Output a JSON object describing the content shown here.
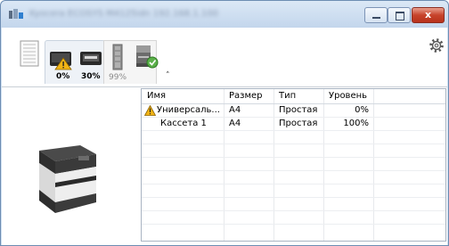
{
  "window": {
    "title": "Kyocera ECOSYS M4125idn 192.168.1.100",
    "minimize_icon": "minimize-icon",
    "maximize_icon": "maximize-icon",
    "close_label": "x",
    "accent_close": "#c7432b",
    "accent_title": "#c3d6ec"
  },
  "toolbar": {
    "toner_black_pct": "0%",
    "toner_cassette_pct": "30%",
    "waste_toner_pct": "99%",
    "icons": [
      "paper-stack-icon",
      "toner-warning-icon",
      "toner-cassette-icon",
      "waste-toner-icon",
      "device-status-icon",
      "collapse-icon",
      "settings-gear-icon"
    ]
  },
  "table": {
    "columns": [
      "Имя",
      "Размер",
      "Тип",
      "Уровень"
    ],
    "rows": [
      {
        "name": "Универсаль...",
        "size": "A4",
        "type": "Простая",
        "level": "0%",
        "warning": true
      },
      {
        "name": "Кассета 1",
        "size": "A4",
        "type": "Простая",
        "level": "100%",
        "warning": false
      }
    ]
  },
  "colors": {
    "warning": "#f2b415",
    "status_ok": "#5bb04a",
    "grid_border": "#a9b4c2"
  }
}
